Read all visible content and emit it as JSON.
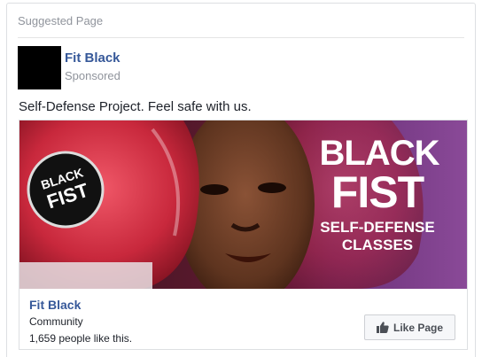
{
  "card": {
    "header": "Suggested Page",
    "page_name": "Fit Black",
    "sponsored": "Sponsored",
    "post_text": "Self-Defense Project. Feel safe with us."
  },
  "ad": {
    "image": {
      "badge_line1": "BLACK",
      "badge_line2": "FIST",
      "headline_line1": "BLACK",
      "headline_line2": "FIST",
      "subline1": "SELF-DEFENSE",
      "subline2": "CLASSES"
    },
    "footer": {
      "page_name": "Fit Black",
      "category": "Community",
      "likes": "1,659 people like this.",
      "like_button_label": "Like Page"
    }
  },
  "colors": {
    "link": "#365899",
    "muted": "#90949c",
    "glove_red": "#c8283c",
    "banner_purple": "#6a2f78"
  },
  "icons": {
    "like_button": "thumbs-up-icon"
  }
}
